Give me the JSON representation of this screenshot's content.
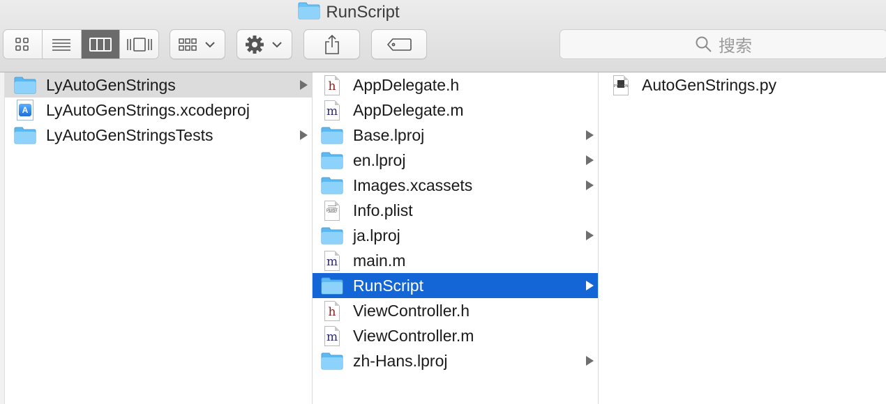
{
  "window": {
    "title": "RunScript"
  },
  "toolbar": {
    "view_buttons": [
      "icon-view",
      "list-view",
      "column-view",
      "cover-flow-view"
    ],
    "active_view": "column-view",
    "arrange_icon": "arrange-grid-icon",
    "action_icon": "gear-icon",
    "share_icon": "share-icon",
    "tag_icon": "tag-icon"
  },
  "search": {
    "placeholder": "搜索"
  },
  "columns": {
    "col1": [
      {
        "name": "LyAutoGenStrings",
        "icon": "folder",
        "arrow": true,
        "selected": "gray"
      },
      {
        "name": "LyAutoGenStrings.xcodeproj",
        "icon": "xcodeproj",
        "arrow": false
      },
      {
        "name": "LyAutoGenStringsTests",
        "icon": "folder",
        "arrow": true
      }
    ],
    "col2": [
      {
        "name": "AppDelegate.h",
        "icon": "h-file",
        "arrow": false
      },
      {
        "name": "AppDelegate.m",
        "icon": "m-file",
        "arrow": false
      },
      {
        "name": "Base.lproj",
        "icon": "folder",
        "arrow": true
      },
      {
        "name": "en.lproj",
        "icon": "folder",
        "arrow": true
      },
      {
        "name": "Images.xcassets",
        "icon": "folder",
        "arrow": true
      },
      {
        "name": "Info.plist",
        "icon": "plist-file",
        "arrow": false
      },
      {
        "name": "ja.lproj",
        "icon": "folder",
        "arrow": true
      },
      {
        "name": "main.m",
        "icon": "m-file",
        "arrow": false
      },
      {
        "name": "RunScript",
        "icon": "folder",
        "arrow": true,
        "selected": "blue"
      },
      {
        "name": "ViewController.h",
        "icon": "h-file",
        "arrow": false
      },
      {
        "name": "ViewController.m",
        "icon": "m-file",
        "arrow": false
      },
      {
        "name": "zh-Hans.lproj",
        "icon": "folder",
        "arrow": true
      }
    ],
    "col3": [
      {
        "name": "AutoGenStrings.py",
        "icon": "python-file",
        "arrow": false
      }
    ]
  },
  "file_badges": {
    "h": "h",
    "m": "m",
    "plist": "PLIST",
    "python": "PYTHON"
  },
  "colors": {
    "selection_blue": "#1466d6",
    "selection_gray": "#dcdcdc",
    "folder": "#6cc3f5"
  }
}
